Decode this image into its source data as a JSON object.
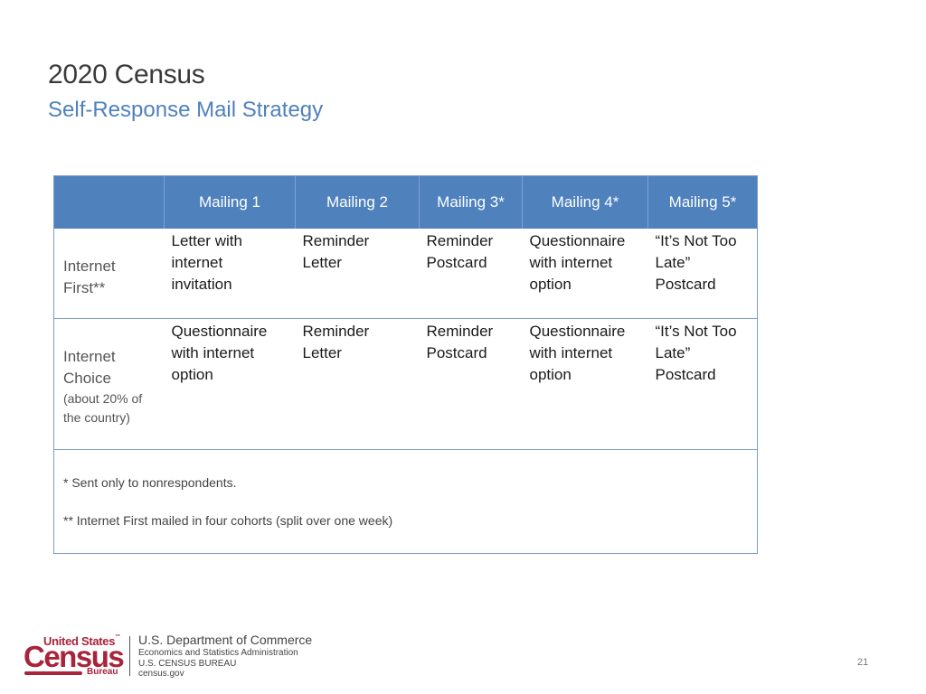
{
  "header": {
    "title": "2020 Census",
    "subtitle": "Self-Response Mail Strategy"
  },
  "table": {
    "columns": [
      "",
      "Mailing 1",
      "Mailing 2",
      "Mailing 3*",
      "Mailing 4*",
      "Mailing 5*"
    ],
    "rows": [
      {
        "label": "Internet\nFirst**",
        "note": "",
        "cells": [
          "Letter with\ninternet\ninvitation",
          "Reminder\nLetter",
          "Reminder\nPostcard",
          "Questionnaire\nwith internet\noption",
          "“It’s Not Too\nLate”\nPostcard"
        ]
      },
      {
        "label": "Internet\nChoice",
        "note": "(about 20% of\nthe country)",
        "cells": [
          "Questionnaire\nwith internet\noption",
          "Reminder\nLetter",
          "Reminder\nPostcard",
          "Questionnaire\nwith internet\noption",
          "“It’s Not Too\nLate”\nPostcard"
        ]
      }
    ],
    "footnotes": [
      "* Sent only to nonrespondents.",
      "** Internet First mailed in four cohorts (split over one week)"
    ]
  },
  "footer": {
    "logo": {
      "line1": "United States",
      "tm": "™",
      "line2": "Census",
      "line3": "Bureau"
    },
    "dept": {
      "line1": "U.S. Department of Commerce",
      "line2": "Economics and Statistics Administration",
      "line3": "U.S. CENSUS BUREAU",
      "line4": "census.gov"
    },
    "page_number": "21"
  },
  "colors": {
    "header_fill": "#4f81bd",
    "subtitle": "#4f81bd",
    "brand_red": "#a8243a"
  }
}
